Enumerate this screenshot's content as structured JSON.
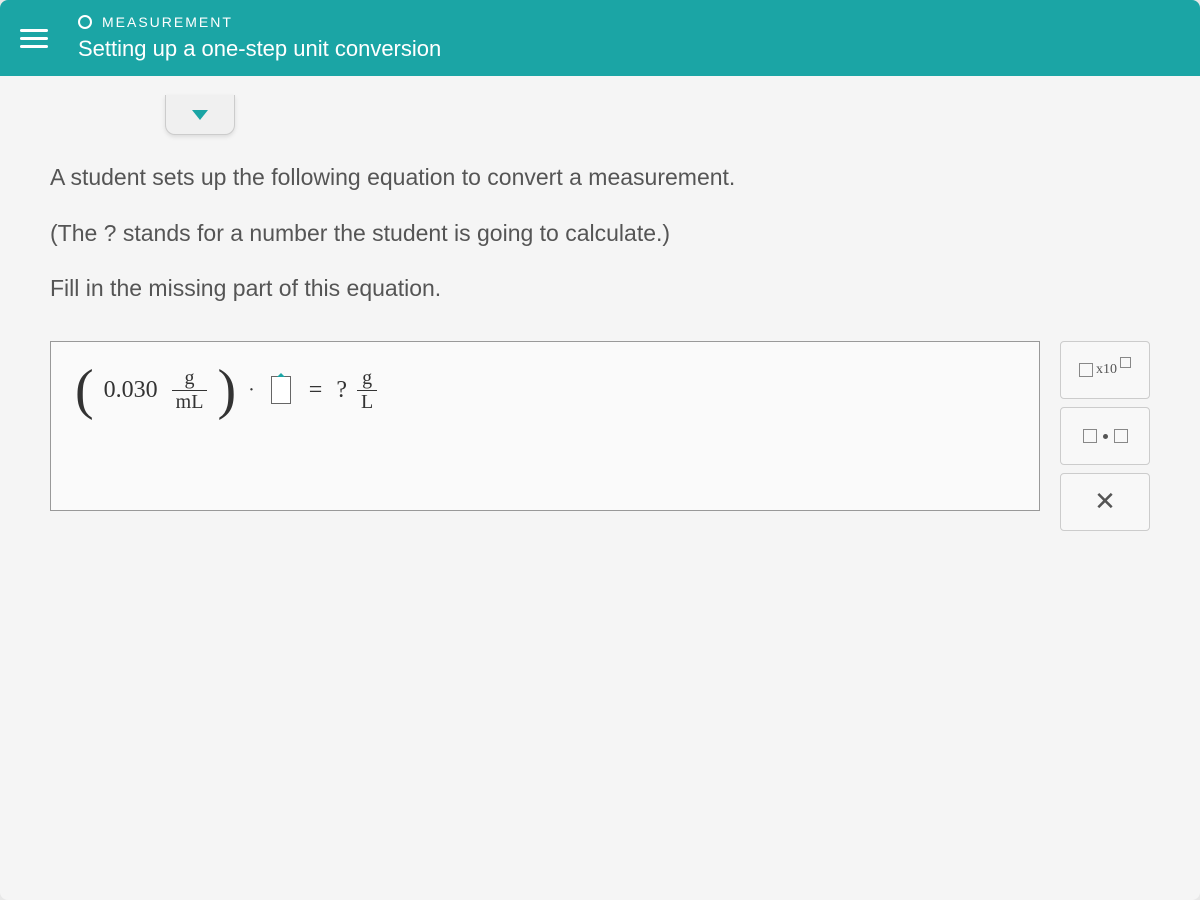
{
  "header": {
    "category": "MEASUREMENT",
    "title": "Setting up a one-step unit conversion"
  },
  "question": {
    "line1": "A student sets up the following equation to convert a measurement.",
    "line2": "(The ? stands for a number the student is going to calculate.)",
    "line3": "Fill in the missing part of this equation."
  },
  "equation": {
    "value": "0.030",
    "leftUnit": {
      "numerator": "g",
      "denominator": "mL"
    },
    "equals": "=",
    "question": "?",
    "rightUnit": {
      "numerator": "g",
      "denominator": "L"
    }
  },
  "tools": {
    "sciLabel": "x10",
    "clearLabel": "✕"
  }
}
